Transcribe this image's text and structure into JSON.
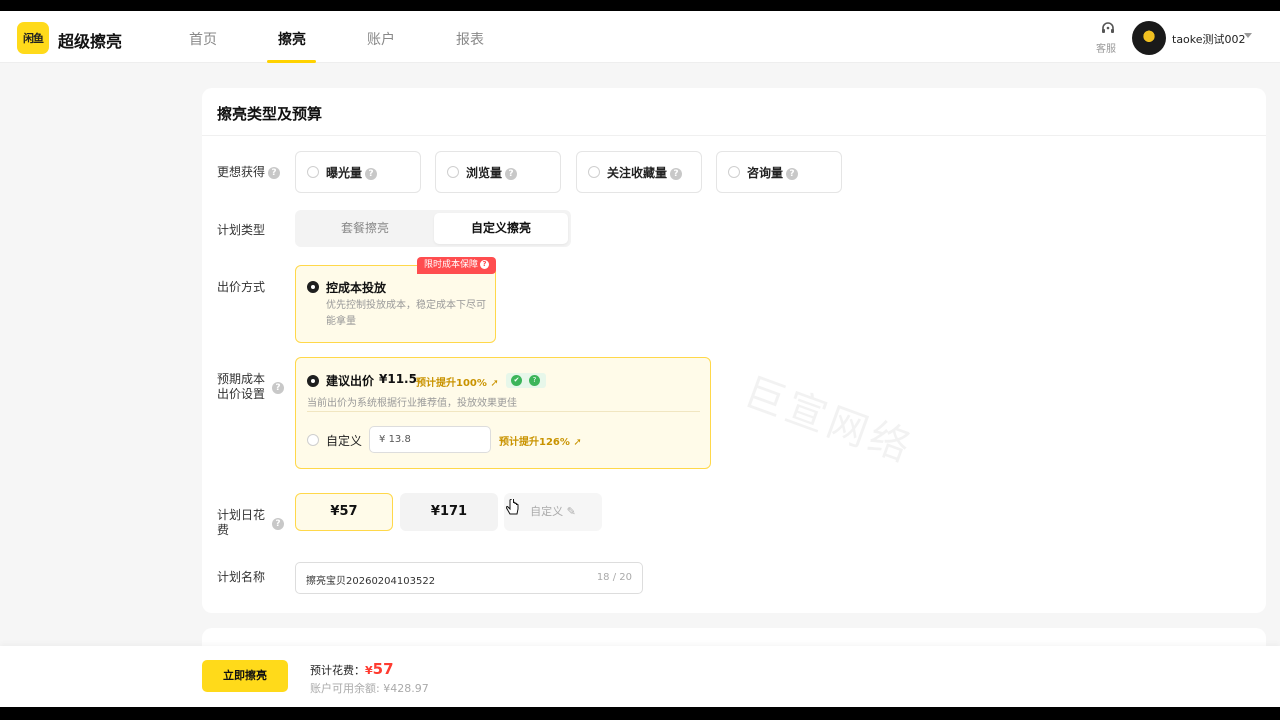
{
  "app": {
    "logo_mark": "闲鱼",
    "name": "超级擦亮"
  },
  "nav": {
    "tabs": [
      {
        "label": "首页"
      },
      {
        "label": "擦亮"
      },
      {
        "label": "账户"
      },
      {
        "label": "报表"
      }
    ],
    "active_index": 1
  },
  "header": {
    "service_label": "客服",
    "username": "taoke测试002"
  },
  "form": {
    "title": "擦亮类型及预算",
    "goal": {
      "label": "更想获得",
      "options": [
        {
          "label": "曝光量"
        },
        {
          "label": "浏览量"
        },
        {
          "label": "关注收藏量"
        },
        {
          "label": "咨询量"
        }
      ]
    },
    "plan_type": {
      "label": "计划类型",
      "options": [
        {
          "label": "套餐擦亮"
        },
        {
          "label": "自定义擦亮"
        }
      ],
      "selected": "自定义擦亮"
    },
    "bid_method": {
      "label": "出价方式",
      "promo_tag": "限时成本保障",
      "option_title": "控成本投放",
      "option_desc": "优先控制投放成本，稳定成本下尽可能拿量"
    },
    "expected_cost": {
      "label_line1": "预期成本",
      "label_line2": "出价设置",
      "suggested_label": "建议出价",
      "suggested_price": "¥11.5",
      "suggested_uplift": "预计提升100%",
      "suggested_desc": "当前出价为系统根据行业推荐值，投放效果更佳",
      "custom_label": "自定义",
      "custom_currency": "¥",
      "custom_value": "13.8",
      "custom_uplift": "预计提升126%"
    },
    "daily_budget": {
      "label_line1": "计划日花",
      "label_line2": "费",
      "options": [
        {
          "label": "¥57"
        },
        {
          "label": "¥171"
        }
      ],
      "custom_label": "自定义",
      "selected": "¥57"
    },
    "plan_name": {
      "label": "计划名称",
      "value": "擦亮宝贝20260204103522",
      "counter": "18 / 20"
    }
  },
  "footer": {
    "submit_label": "立即擦亮",
    "estimate_label": "预计花费：",
    "estimate_currency": "¥",
    "estimate_value": "57",
    "balance_text": "账户可用余额: ¥428.97"
  },
  "watermark": "巨宣网络",
  "colors": {
    "brand_yellow": "#ffda1a",
    "accent_red": "#ff3b30",
    "uplift_gold": "#c99300"
  }
}
